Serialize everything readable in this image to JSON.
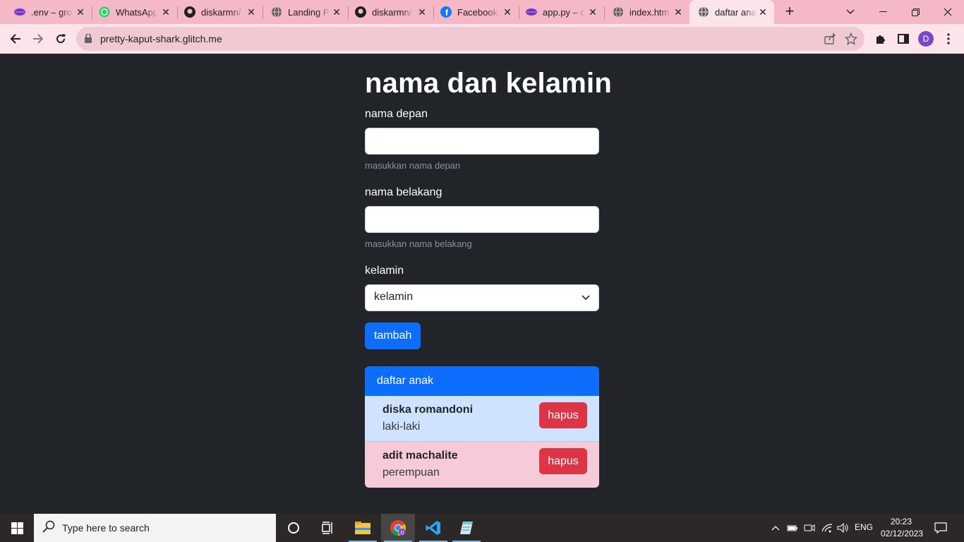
{
  "browser": {
    "tabs": [
      {
        "title": ".env – gro",
        "icon": "glitch-icon"
      },
      {
        "title": "WhatsApp",
        "icon": "whatsapp-icon"
      },
      {
        "title": "diskarmn/",
        "icon": "github-icon"
      },
      {
        "title": "Landing P",
        "icon": "globe-icon"
      },
      {
        "title": "diskarmn/",
        "icon": "github-icon"
      },
      {
        "title": "Facebook",
        "icon": "facebook-icon"
      },
      {
        "title": "app.py – c",
        "icon": "glitch-icon"
      },
      {
        "title": "index.htm",
        "icon": "globe-icon"
      },
      {
        "title": "daftar ana",
        "icon": "globe-icon",
        "active": true
      }
    ],
    "url": "pretty-kaput-shark.glitch.me",
    "profile_initial": "D",
    "tabstrip_color": "#f5b8c6",
    "toolbar_color": "#fbe4ea"
  },
  "page": {
    "heading": "nama dan kelamin",
    "first_name": {
      "label": "nama depan",
      "value": "",
      "help": "masukkan nama depan"
    },
    "last_name": {
      "label": "nama belakang",
      "value": "",
      "help": "masukkan nama belakang"
    },
    "gender": {
      "label": "kelamin",
      "selected": "kelamin"
    },
    "add_button": "tambah",
    "list": {
      "title": "daftar anak",
      "items": [
        {
          "name": "diska romandoni",
          "gender": "laki-laki",
          "delete_label": "hapus",
          "variant": "blue"
        },
        {
          "name": "adit machalite",
          "gender": "perempuan",
          "delete_label": "hapus",
          "variant": "pink"
        }
      ]
    },
    "colors": {
      "background": "#212529",
      "primary": "#0d6efd",
      "danger": "#dc3545",
      "row_blue": "#cfe2ff",
      "row_pink": "#f7cad8"
    }
  },
  "taskbar": {
    "search_placeholder": "Type here to search",
    "language": "ENG",
    "time": "20:23",
    "date": "02/12/2023"
  }
}
